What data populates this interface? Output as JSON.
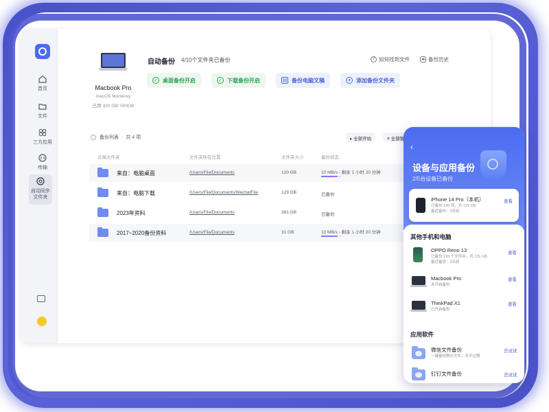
{
  "colors": {
    "accent": "#4b6cf0",
    "green": "#2ba55a",
    "frame": "#4650c8"
  },
  "sidebar": {
    "items": [
      {
        "label": "首页",
        "icon": "home-icon"
      },
      {
        "label": "文件",
        "icon": "folder-icon"
      },
      {
        "label": "三方应用",
        "icon": "apps-icon"
      },
      {
        "label": "传输",
        "icon": "transfer-icon"
      },
      {
        "label": "自动同步文件夹",
        "line1": "自动同步",
        "line2": "文件夹",
        "icon": "sync-icon",
        "active": true
      }
    ]
  },
  "device": {
    "name": "Macbook Pro",
    "os": "macOS Monterey",
    "usage": "已用 320 GB/ 500GB"
  },
  "header": {
    "title": "自动备份",
    "count": "4/10个文件夹已备份",
    "help_link": "如何找到文件",
    "history_link": "备份历史"
  },
  "actions": {
    "desktop_backup": "桌面备份开启",
    "download_backup": "下载备份开启",
    "pc_docs": "备份电脑文稿",
    "add_folder": "添加备份文件夹"
  },
  "list": {
    "label": "备份列表",
    "count": "共 4 项",
    "start_all": "全部开始",
    "pause_all": "全部暂"
  },
  "table": {
    "columns": [
      "云端文件夹",
      "文件夹所在位置",
      "文件夹大小",
      "备份状态"
    ],
    "rows": [
      {
        "name": "来自：电脑桌面",
        "path": "/Users/File/Documents",
        "size": "120 GB",
        "status": "10 MB/s - 剩余 1 小时 20 分钟",
        "progress": 0.8
      },
      {
        "name": "来自：电脑下载",
        "path": "/Users/File/Documents/WechatFile",
        "size": "129 GB",
        "status": "已备份",
        "progress": null
      },
      {
        "name": "2023年资料",
        "path": "/Users/File/Documents",
        "size": "381 GB",
        "status": "已备份",
        "progress": null
      },
      {
        "name": "2017~2020备份资料",
        "path": "/Users/File/Documents",
        "size": "31 GB",
        "status": "10 MB/s - 剩余 1 小时 20 分钟",
        "progress": 0.8
      }
    ]
  },
  "phone": {
    "back": "‹",
    "title": "设备与应用备份",
    "subtitle": "2/5台设备已备份",
    "own_device": {
      "name": "iPhone 14 Pro（本机）",
      "meta1": "已备份 199 项，共 131 GB",
      "meta2": "最近备份：3天前",
      "link": "查看"
    },
    "other_title": "其他手机和电脑",
    "devices": [
      {
        "name": "OPPO Reno 13",
        "meta1": "已备份 199 个文件夹，共 131 GB",
        "meta2": "最近备份：3天前",
        "link": "查看"
      },
      {
        "name": "Macbook Pro",
        "meta1": "未开启备份",
        "meta2": "",
        "link": "查看"
      },
      {
        "name": "ThinkPad X1",
        "meta1": "已开启备份",
        "meta2": "",
        "link": "查看"
      }
    ],
    "apps_title": "应用软件",
    "apps": [
      {
        "name": "微信文件备份",
        "meta": "一键备份聊天文件，永不过期",
        "link": "去试试"
      },
      {
        "name": "钉钉文件备份",
        "meta": "",
        "link": "去试试"
      }
    ]
  }
}
